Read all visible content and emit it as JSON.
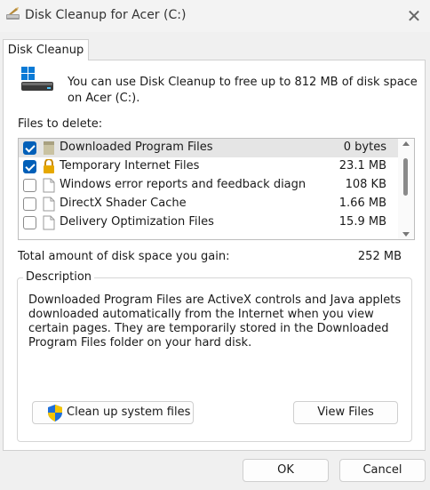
{
  "window": {
    "title": "Disk Cleanup for Acer (C:)"
  },
  "tab": {
    "label": "Disk Cleanup"
  },
  "intro": "You can use Disk Cleanup to free up to 812 MB of disk space on Acer (C:).",
  "files_label": "Files to delete:",
  "files": [
    {
      "name": "Downloaded Program Files",
      "size": "0 bytes",
      "checked": true,
      "icon": "folder-icon",
      "selected": true
    },
    {
      "name": "Temporary Internet Files",
      "size": "23.1 MB",
      "checked": true,
      "icon": "lock-icon",
      "selected": false
    },
    {
      "name": "Windows error reports and feedback diagn...",
      "size": "108 KB",
      "checked": false,
      "icon": "document-icon",
      "selected": false
    },
    {
      "name": "DirectX Shader Cache",
      "size": "1.66 MB",
      "checked": false,
      "icon": "document-icon",
      "selected": false
    },
    {
      "name": "Delivery Optimization Files",
      "size": "15.9 MB",
      "checked": false,
      "icon": "document-icon",
      "selected": false
    }
  ],
  "total": {
    "label": "Total amount of disk space you gain:",
    "value": "252 MB"
  },
  "description": {
    "legend": "Description",
    "text": "Downloaded Program Files are ActiveX controls and Java applets downloaded automatically from the Internet when you view certain pages. They are temporarily stored in the Downloaded Program Files folder on your hard disk."
  },
  "buttons": {
    "cleanup_system": "Clean up system files",
    "view_files": "View Files",
    "ok": "OK",
    "cancel": "Cancel"
  },
  "colors": {
    "accent": "#005fb8",
    "shield_blue": "#1e6fd9",
    "shield_yellow": "#f5c400"
  }
}
